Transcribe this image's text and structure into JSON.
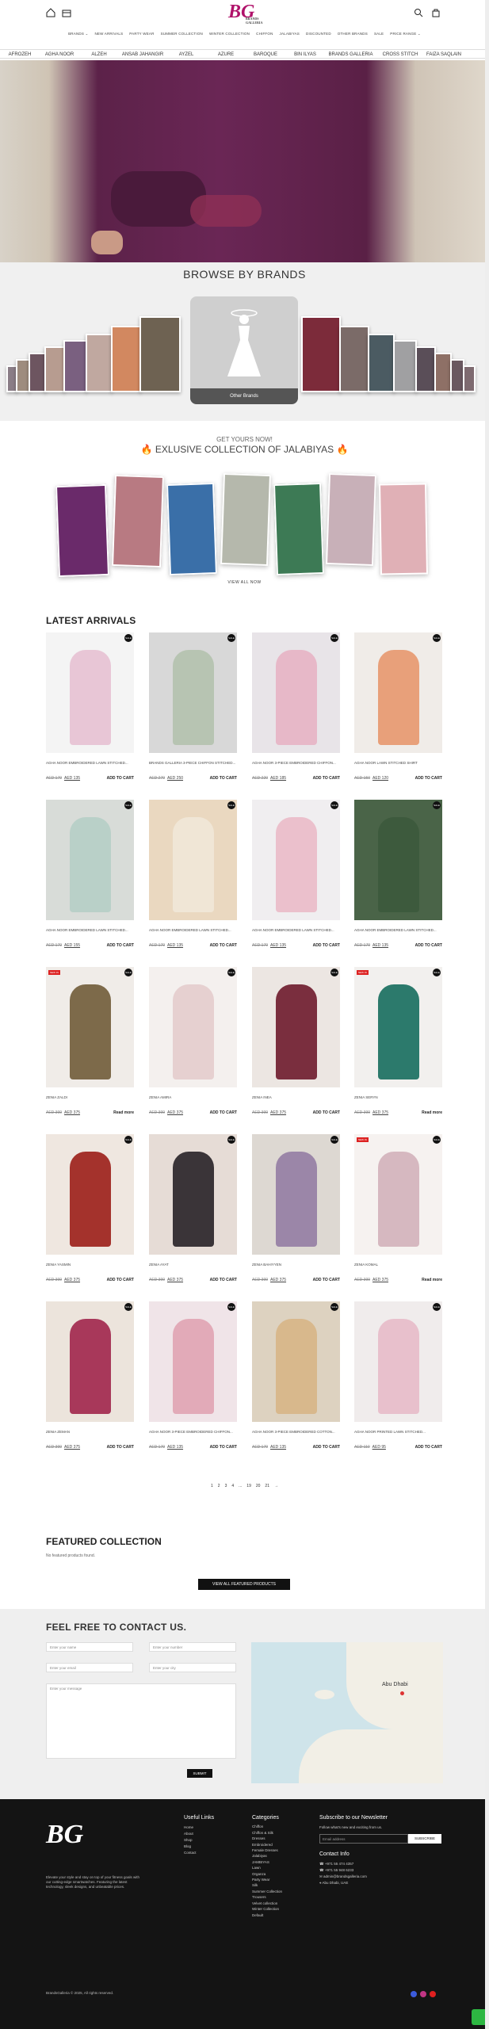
{
  "header": {
    "logo_text": "BG",
    "logo_sub": "BRANDS GALLERIA"
  },
  "nav": {
    "items": [
      "BRANDS ⌄",
      "NEW ARRIVALS",
      "PARTY WEAR",
      "SUMMER COLLECTION",
      "WINTER COLLECTION",
      "CHIFFON",
      "JALABIYAS",
      "DISCOUNTED",
      "OTHER BRANDS",
      "SALE",
      "PRICE RANGE ⌄"
    ]
  },
  "brandbar": {
    "items": [
      "AFROZEH",
      "AGHA NOOR",
      "ALZEH",
      "ANSAB JAHANGIR",
      "AYZEL",
      "AZURE",
      "BAROQUE",
      "BIN ILYAS",
      "BRANDS GALLERIA",
      "CROSS STITCH",
      "FAIZA SAQLAIN"
    ]
  },
  "browse": {
    "title": "BROWSE BY BRANDS",
    "center_label": "Other Brands"
  },
  "jalabiyas": {
    "small": "GET YOURS NOW!",
    "big": "EXLUSIVE COLLECTION OF JALABIYAS",
    "view_all": "VIEW ALL NOW"
  },
  "latest": {
    "title": "LATEST ARRIVALS"
  },
  "products": [
    {
      "name": "AGHA NOOR EMBROIDERED LAWN STITCHED...",
      "old": "AED 179",
      "new": "AED 135",
      "action": "ADD TO CART",
      "badge": "SALE"
    },
    {
      "name": "BRANDS GALLERIA 3-PIECE CHIFFON STITCHED...",
      "old": "AED 279",
      "new": "AED 250",
      "action": "ADD TO CART",
      "badge": "SALE"
    },
    {
      "name": "AGHA NOOR 3-PIECE EMBROIDERED CHIFFON...",
      "old": "AED 220",
      "new": "AED 185",
      "action": "ADD TO CART",
      "badge": "SALE"
    },
    {
      "name": "AGHA NOOR LAWN STITCHED SHIRT",
      "old": "AED 150",
      "new": "AED 120",
      "action": "ADD TO CART",
      "badge": "SALE"
    },
    {
      "name": "AGHA NOOR EMBROIDERED LAWN STITCHED...",
      "old": "AED 179",
      "new": "AED 155",
      "action": "ADD TO CART",
      "badge": "SALE"
    },
    {
      "name": "AGHA NOOR EMBROIDERED LAWN STITCHED...",
      "old": "AED 179",
      "new": "AED 135",
      "action": "ADD TO CART",
      "badge": "SALE"
    },
    {
      "name": "AGHA NOOR EMBROIDERED LAWN STITCHED...",
      "old": "AED 179",
      "new": "AED 135",
      "action": "ADD TO CART",
      "badge": "SALE"
    },
    {
      "name": "AGHA NOOR EMBROIDERED LAWN STITCHED...",
      "old": "AED 179",
      "new": "AED 135",
      "action": "ADD TO CART",
      "badge": "SALE"
    },
    {
      "name": "ZENIA ZALDI",
      "old": "AED 399",
      "new": "AED 375",
      "action": "Read more",
      "badge": "SALE",
      "newin": "NEW IN"
    },
    {
      "name": "ZENIA AMIRA",
      "old": "AED 399",
      "new": "AED 375",
      "action": "ADD TO CART",
      "badge": "SALE"
    },
    {
      "name": "ZENIA INEA",
      "old": "AED 399",
      "new": "AED 375",
      "action": "ADD TO CART",
      "badge": "SALE"
    },
    {
      "name": "ZENIA SERYN",
      "old": "AED 399",
      "new": "AED 375",
      "action": "Read more",
      "badge": "SALE",
      "newin": "NEW IN"
    },
    {
      "name": "ZENIA YASMIN",
      "old": "AED 399",
      "new": "AED 375",
      "action": "ADD TO CART",
      "badge": "SALE"
    },
    {
      "name": "ZENIA AYAT",
      "old": "AED 399",
      "new": "AED 375",
      "action": "ADD TO CART",
      "badge": "SALE"
    },
    {
      "name": "ZENIA BAHIYYEN",
      "old": "AED 399",
      "new": "AED 375",
      "action": "ADD TO CART",
      "badge": "SALE"
    },
    {
      "name": "ZENIA KOMAL",
      "old": "AED 399",
      "new": "AED 375",
      "action": "Read more",
      "badge": "SALE",
      "newin": "NEW IN"
    },
    {
      "name": "ZENIA ZEMAN",
      "old": "AED 399",
      "new": "AED 375",
      "action": "ADD TO CART",
      "badge": "SALE"
    },
    {
      "name": "AGHA NOOR 3-PIECE EMBROIDERED CHIFFON...",
      "old": "AED 179",
      "new": "AED 135",
      "action": "ADD TO CART",
      "badge": "SALE"
    },
    {
      "name": "AGHA NOOR 3-PIECE EMBROIDERED COTTON...",
      "old": "AED 179",
      "new": "AED 135",
      "action": "ADD TO CART",
      "badge": "SALE"
    },
    {
      "name": "AGHA NOOR PRINTED LAWN STITCHED...",
      "old": "AED 110",
      "new": "AED 95",
      "action": "ADD TO CART",
      "badge": "SALE"
    }
  ],
  "pager": [
    "1",
    "2",
    "3",
    "4",
    "...",
    "19",
    "20",
    "21",
    "→"
  ],
  "featured": {
    "title": "FEATURED COLLECTION",
    "empty": "No featured products found.",
    "button": "VIEW ALL FEATURED PRODUCTS"
  },
  "contact": {
    "title": "FEEL FREE TO CONTACT US.",
    "name": "Enter your name",
    "number": "Enter your number",
    "email": "Enter your email",
    "city": "Enter your city",
    "message": "Enter your message",
    "submit": "SUBMIT",
    "map_label": "Abu Dhabi"
  },
  "footer": {
    "desc": "Elevate your style and stay on top of your fitness goals with our cutting-edge smartwatches. Featuring the latest technology, sleek designs, and unbeatable prices.",
    "useful_title": "Useful Links",
    "useful": [
      "Home",
      "About",
      "Shop",
      "Blog",
      "Contact"
    ],
    "cat_title": "Categories",
    "cats": [
      "Chiffon",
      "Chiffon & Silk",
      "Dresses",
      "Embroidered",
      "Female Dresses",
      "Jalabiyas",
      "JAMBIYAS",
      "Lawn",
      "Organza",
      "Party Wear",
      "Silk",
      "Summer Collection",
      "Trousers",
      "Velvet collection",
      "Winter Collection",
      "Default"
    ],
    "news_title": "Subscribe to our Newsletter",
    "news_sub": "Follow what's new and exciting from us.",
    "news_placeholder": "Email address",
    "news_btn": "SUBSCRIBE",
    "contact_title": "Contact Info",
    "phone1": "+971 55 474 4357",
    "phone2": "+971 55 948 6233",
    "email": "admin@brandsgalleria.com",
    "address": "Abu Dhabi, UAE",
    "copyright": "BrandsGalleria © 2025, All rights reserved."
  }
}
